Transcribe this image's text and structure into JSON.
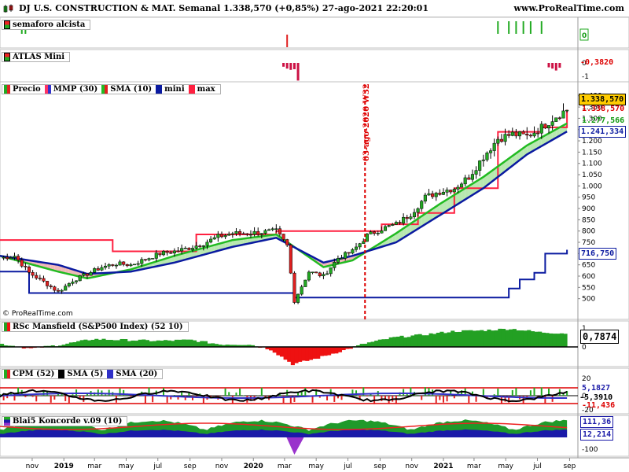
{
  "header": {
    "title": "DJ U.S. CONSTRUCTION & MAT. Semanal 1.338,570 (+0,85%) 27-ago-2021 22:20:01",
    "site": "www.ProRealTime.com"
  },
  "copyright": "© ProRealTime.com",
  "colors": {
    "up": "#22aa22",
    "down": "#e02020",
    "ema": "#ff3366",
    "sma": "#22bb22",
    "mini": "#0a1aa0",
    "max": "#ff2040",
    "pos_fill": "#b8e8b0",
    "neg_fill": "#f0b8b8",
    "rsc_pos": "#23a023",
    "rsc_neg": "#ee1111",
    "vline": "#dd0000"
  },
  "chart_data": [
    {
      "id": "semaforo",
      "type": "bar",
      "legend": [
        "semaforo alcista"
      ],
      "value_label": "0",
      "signals_up_dates": [
        "2018-10-12",
        "2018-10-19",
        "2021-04-16",
        "2021-05-07",
        "2021-05-21",
        "2021-06-04",
        "2021-06-18",
        "2021-07-09"
      ],
      "signals_down_dates": [
        "2020-03-06"
      ]
    },
    {
      "id": "atlas",
      "type": "bar",
      "legend": [
        "ATLAS Mini"
      ],
      "ticks": [
        "0",
        "-1"
      ],
      "value_label": "-0,3820",
      "bars": [
        {
          "date": "2020-02-28",
          "value": -0.3
        },
        {
          "date": "2020-03-06",
          "value": -0.45
        },
        {
          "date": "2020-03-13",
          "value": -0.55
        },
        {
          "date": "2020-03-20",
          "value": -0.5
        },
        {
          "date": "2020-03-27",
          "value": -1.4
        },
        {
          "date": "2021-07-23",
          "value": -0.35
        },
        {
          "date": "2021-07-30",
          "value": -0.45
        },
        {
          "date": "2021-08-06",
          "value": -0.6
        },
        {
          "date": "2021-08-13",
          "value": -0.38
        }
      ]
    },
    {
      "id": "price",
      "type": "line",
      "legend": [
        "Precio",
        "MMP (30)",
        "SMA (10)",
        "mini",
        "max"
      ],
      "y_ticks": [
        "1.400",
        "1.350",
        "1.300",
        "1.250",
        "1.200",
        "1.150",
        "1.100",
        "1.050",
        "1.000",
        "950",
        "900",
        "850",
        "800",
        "750",
        "700",
        "650",
        "600",
        "550",
        "500"
      ],
      "ylim": [
        450,
        1420
      ],
      "labels": {
        "last": "1.338,570",
        "sma": "1.277,566",
        "ema": "1.241,334",
        "mini": "716,750"
      },
      "annotation": {
        "date": "2020-08-03",
        "text": "03-ago-2020 W32"
      },
      "close_points": [
        [
          "2018-08-31",
          680
        ],
        [
          "2018-09-28",
          690
        ],
        [
          "2018-10-26",
          615
        ],
        [
          "2018-11-23",
          575
        ],
        [
          "2018-12-21",
          530
        ],
        [
          "2019-01-18",
          580
        ],
        [
          "2019-02-15",
          610
        ],
        [
          "2019-03-15",
          640
        ],
        [
          "2019-04-12",
          655
        ],
        [
          "2019-05-10",
          650
        ],
        [
          "2019-06-07",
          675
        ],
        [
          "2019-07-05",
          700
        ],
        [
          "2019-08-02",
          710
        ],
        [
          "2019-08-30",
          725
        ],
        [
          "2019-09-27",
          745
        ],
        [
          "2019-10-25",
          775
        ],
        [
          "2019-11-22",
          790
        ],
        [
          "2019-12-20",
          790
        ],
        [
          "2020-01-17",
          795
        ],
        [
          "2020-02-14",
          800
        ],
        [
          "2020-03-06",
          735
        ],
        [
          "2020-03-20",
          490
        ],
        [
          "2020-04-17",
          620
        ],
        [
          "2020-05-15",
          600
        ],
        [
          "2020-06-12",
          680
        ],
        [
          "2020-07-10",
          710
        ],
        [
          "2020-08-07",
          780
        ],
        [
          "2020-09-04",
          810
        ],
        [
          "2020-10-02",
          830
        ],
        [
          "2020-10-30",
          875
        ],
        [
          "2020-11-27",
          950
        ],
        [
          "2020-12-25",
          975
        ],
        [
          "2021-01-22",
          990
        ],
        [
          "2021-02-19",
          1040
        ],
        [
          "2021-03-19",
          1130
        ],
        [
          "2021-04-16",
          1210
        ],
        [
          "2021-05-14",
          1230
        ],
        [
          "2021-06-11",
          1220
        ],
        [
          "2021-07-09",
          1260
        ],
        [
          "2021-08-06",
          1310
        ],
        [
          "2021-08-27",
          1338.57
        ]
      ],
      "sma_points": [
        [
          "2018-08-31",
          690
        ],
        [
          "2018-12-21",
          620
        ],
        [
          "2019-02-15",
          590
        ],
        [
          "2019-05-10",
          630
        ],
        [
          "2019-08-02",
          690
        ],
        [
          "2019-11-22",
          760
        ],
        [
          "2020-02-14",
          785
        ],
        [
          "2020-05-15",
          640
        ],
        [
          "2020-07-10",
          670
        ],
        [
          "2020-10-02",
          790
        ],
        [
          "2020-12-25",
          920
        ],
        [
          "2021-03-19",
          1040
        ],
        [
          "2021-06-11",
          1180
        ],
        [
          "2021-08-27",
          1277.566
        ]
      ],
      "ema_points": [
        [
          "2018-08-31",
          690
        ],
        [
          "2018-12-21",
          650
        ],
        [
          "2019-02-15",
          610
        ],
        [
          "2019-05-10",
          620
        ],
        [
          "2019-08-02",
          660
        ],
        [
          "2019-11-22",
          730
        ],
        [
          "2020-02-14",
          770
        ],
        [
          "2020-05-15",
          660
        ],
        [
          "2020-07-10",
          690
        ],
        [
          "2020-10-02",
          750
        ],
        [
          "2020-12-25",
          870
        ],
        [
          "2021-03-19",
          990
        ],
        [
          "2021-06-11",
          1140
        ],
        [
          "2021-08-27",
          1241.334
        ]
      ],
      "mini_steps": [
        [
          "2018-08-31",
          620
        ],
        [
          "2018-10-19",
          620
        ],
        [
          "2018-10-26",
          525
        ],
        [
          "2020-03-06",
          525
        ],
        [
          "2020-03-20",
          505
        ],
        [
          "2021-04-30",
          505
        ],
        [
          "2021-05-07",
          545
        ],
        [
          "2021-05-28",
          585
        ],
        [
          "2021-06-25",
          615
        ],
        [
          "2021-07-16",
          700
        ],
        [
          "2021-08-27",
          716.75
        ]
      ],
      "max_steps": [
        [
          "2018-08-31",
          760
        ],
        [
          "2019-03-01",
          760
        ],
        [
          "2019-04-05",
          710
        ],
        [
          "2019-09-13",
          785
        ],
        [
          "2020-02-14",
          800
        ],
        [
          "2020-08-14",
          800
        ],
        [
          "2020-09-04",
          830
        ],
        [
          "2020-11-13",
          880
        ],
        [
          "2021-01-22",
          990
        ],
        [
          "2021-04-16",
          1240
        ],
        [
          "2021-07-09",
          1260
        ],
        [
          "2021-08-27",
          1338
        ]
      ]
    },
    {
      "id": "rsc",
      "type": "area",
      "legend": [
        "RSc Mansfield (S&P500 Index) (52 10)"
      ],
      "ticks": [
        "1",
        "0"
      ],
      "value_label": "0,7874",
      "points": [
        [
          "2018-08-31",
          0.2
        ],
        [
          "2018-11-02",
          -0.1
        ],
        [
          "2019-01-04",
          0.15
        ],
        [
          "2019-03-01",
          0.45
        ],
        [
          "2019-05-03",
          0.4
        ],
        [
          "2019-07-05",
          0.35
        ],
        [
          "2019-09-06",
          0.4
        ],
        [
          "2019-11-01",
          0.15
        ],
        [
          "2019-12-27",
          0.15
        ],
        [
          "2020-02-07",
          -0.15
        ],
        [
          "2020-03-20",
          -1.0
        ],
        [
          "2020-05-01",
          -0.7
        ],
        [
          "2020-06-26",
          -0.2
        ],
        [
          "2020-08-07",
          0.2
        ],
        [
          "2020-10-02",
          0.55
        ],
        [
          "2020-11-27",
          0.7
        ],
        [
          "2021-01-22",
          0.9
        ],
        [
          "2021-03-19",
          0.95
        ],
        [
          "2021-05-14",
          1.05
        ],
        [
          "2021-07-09",
          0.85
        ],
        [
          "2021-08-27",
          0.7874
        ]
      ]
    },
    {
      "id": "cpm",
      "type": "bar",
      "legend": [
        "CPM (52)",
        "SMA (5)",
        "SMA (20)"
      ],
      "ticks": [
        "20",
        "0",
        "-20"
      ],
      "value_labels": [
        "5,1827",
        "-5,3910",
        "-11,436"
      ]
    },
    {
      "id": "koncorde",
      "type": "area",
      "legend": [
        "Blai5 Koncorde v.09 (10)"
      ],
      "ticks": [
        "0",
        "-100"
      ],
      "value_labels": [
        "111,36",
        "12,214"
      ]
    }
  ],
  "x_axis": {
    "start": "2018-08-31",
    "end": "2021-09-17",
    "labels": [
      {
        "date": "2018-11-01",
        "text": "nov",
        "bold": false
      },
      {
        "date": "2019-01-01",
        "text": "2019",
        "bold": true
      },
      {
        "date": "2019-03-01",
        "text": "mar",
        "bold": false
      },
      {
        "date": "2019-05-01",
        "text": "may",
        "bold": false
      },
      {
        "date": "2019-07-01",
        "text": "jul",
        "bold": false
      },
      {
        "date": "2019-09-01",
        "text": "sep",
        "bold": false
      },
      {
        "date": "2019-11-01",
        "text": "nov",
        "bold": false
      },
      {
        "date": "2020-01-01",
        "text": "2020",
        "bold": true
      },
      {
        "date": "2020-03-01",
        "text": "mar",
        "bold": false
      },
      {
        "date": "2020-05-01",
        "text": "may",
        "bold": false
      },
      {
        "date": "2020-07-01",
        "text": "jul",
        "bold": false
      },
      {
        "date": "2020-09-01",
        "text": "sep",
        "bold": false
      },
      {
        "date": "2020-11-01",
        "text": "nov",
        "bold": false
      },
      {
        "date": "2021-01-01",
        "text": "2021",
        "bold": true
      },
      {
        "date": "2021-03-01",
        "text": "mar",
        "bold": false
      },
      {
        "date": "2021-05-01",
        "text": "may",
        "bold": false
      },
      {
        "date": "2021-07-01",
        "text": "jul",
        "bold": false
      },
      {
        "date": "2021-09-01",
        "text": "sep",
        "bold": false
      }
    ]
  }
}
